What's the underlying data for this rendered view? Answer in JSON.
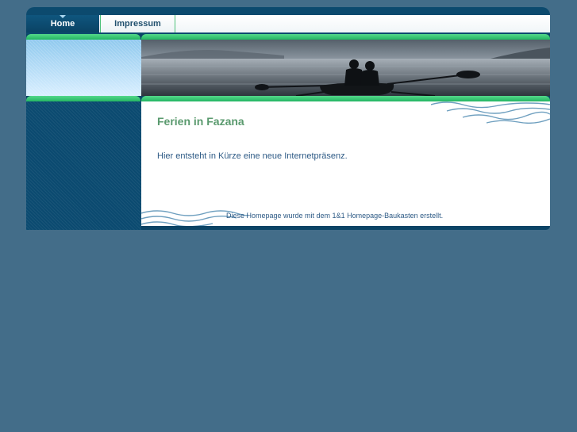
{
  "nav": {
    "tabs": [
      {
        "label": "Home",
        "active": true
      },
      {
        "label": "Impressum",
        "active": false
      }
    ]
  },
  "main": {
    "title": "Ferien in Fazana",
    "text": "Hier entsteht in Kürze eine neue Internetpräsenz.",
    "footer": "Diese Homepage wurde mit dem 1&1 Homepage-Baukasten erstellt."
  },
  "colors": {
    "background": "#436d89",
    "nav_dark": "#0c4a6e",
    "accent_green": "#23b563",
    "title_green": "#5a9a6e",
    "text_blue": "#2d5a85"
  }
}
